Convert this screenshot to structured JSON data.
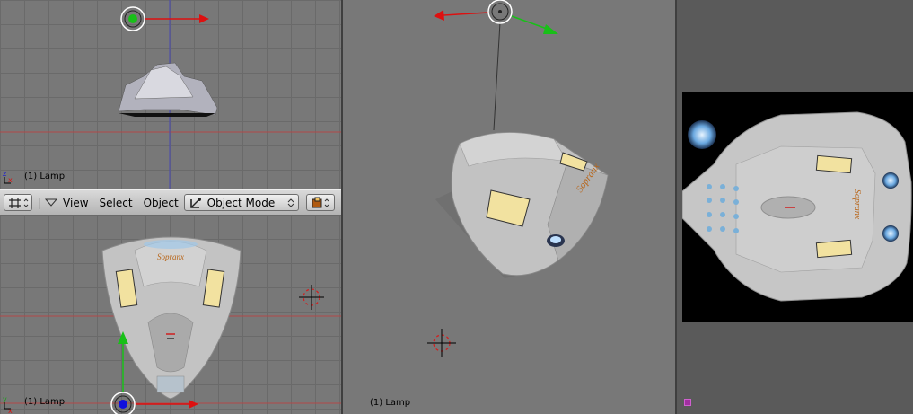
{
  "header": {
    "menus": [
      "View",
      "Select",
      "Object"
    ],
    "mode_label": "Object Mode"
  },
  "viewports": {
    "front": {
      "status": "(1) Lamp"
    },
    "top": {
      "status": "(1) Lamp"
    },
    "camera": {
      "status": "(1) Lamp"
    }
  },
  "model_text": {
    "hull_logo": "Sopranx"
  },
  "colors": {
    "grid_bg": "#787878",
    "camera_bg": "#787878",
    "image_editor_bg": "#5a5a5a",
    "axis_x": "#dd1010",
    "axis_y": "#10bb10",
    "axis_z": "#1010dd"
  }
}
